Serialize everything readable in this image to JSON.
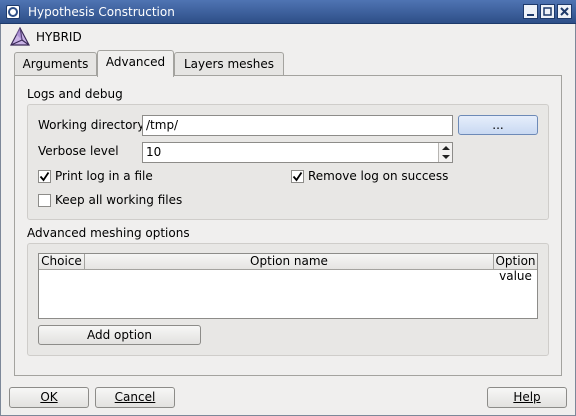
{
  "window": {
    "title": "Hypothesis Construction"
  },
  "header": {
    "label": "HYBRID"
  },
  "tabs": [
    {
      "label": "Arguments"
    },
    {
      "label": "Advanced"
    },
    {
      "label": "Layers meshes"
    }
  ],
  "logs": {
    "section_title": "Logs and debug",
    "working_dir_label": "Working directory",
    "working_dir_value": "/tmp/",
    "browse_label": "...",
    "verbose_label": "Verbose level",
    "verbose_value": "10",
    "print_log_label": "Print log in a file",
    "print_log_checked": true,
    "remove_log_label": "Remove log on success",
    "remove_log_checked": true,
    "keep_files_label": "Keep all working files",
    "keep_files_checked": false
  },
  "advanced": {
    "section_title": "Advanced meshing options",
    "columns": [
      "Choice",
      "Option name",
      "Option value"
    ],
    "add_option_label": "Add option"
  },
  "footer": {
    "ok_label": "OK",
    "cancel_label": "Cancel",
    "help_label": "Help"
  },
  "icons": {
    "window_icon": "app-icon",
    "hybrid_icon": "tetrahedral-mesh-icon",
    "minimize": "minimize-icon",
    "maximize": "maximize-icon",
    "close": "close-icon"
  }
}
